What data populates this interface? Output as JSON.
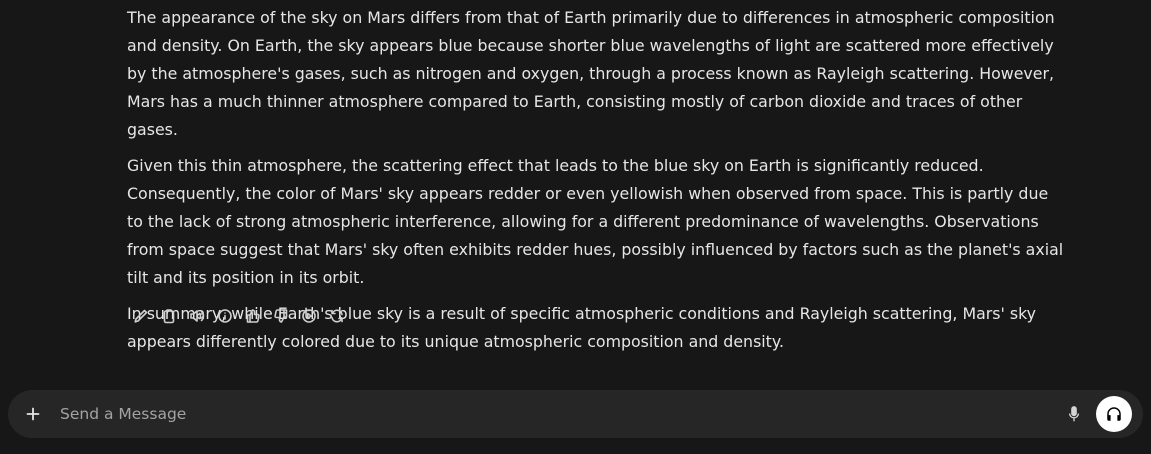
{
  "message": {
    "paragraphs": [
      "The appearance of the sky on Mars differs from that of Earth primarily due to differences in atmospheric composition and density. On Earth, the sky appears blue because shorter blue wavelengths of light are scattered more effectively by the atmosphere's gases, such as nitrogen and oxygen, through a process known as Rayleigh scattering. However, Mars has a much thinner atmosphere compared to Earth, consisting mostly of carbon dioxide and traces of other gases.",
      "Given this thin atmosphere, the scattering effect that leads to the blue sky on Earth is significantly reduced. Consequently, the color of Mars' sky appears redder or even yellowish when observed from space. This is partly due to the lack of strong atmospheric interference, allowing for a different predominance of wavelengths. Observations from space suggest that Mars' sky often exhibits redder hues, possibly influenced by factors such as the planet's axial tilt and its position in its orbit.",
      "In summary, while Earth's blue sky is a result of specific atmospheric conditions and Rayleigh scattering, Mars' sky appears differently colored due to its unique atmospheric composition and density."
    ]
  },
  "actions": [
    "pencil-icon",
    "clipboard-icon",
    "speaker-icon",
    "info-icon",
    "thumbs-up-icon",
    "thumbs-down-icon",
    "play-circle-icon",
    "refresh-icon"
  ],
  "composer": {
    "placeholder": "Send a Message",
    "value": ""
  },
  "colors": {
    "background": "#171717",
    "composer_bg": "#262626",
    "text": "#e6e6e6",
    "voice_button_bg": "#ffffff"
  }
}
